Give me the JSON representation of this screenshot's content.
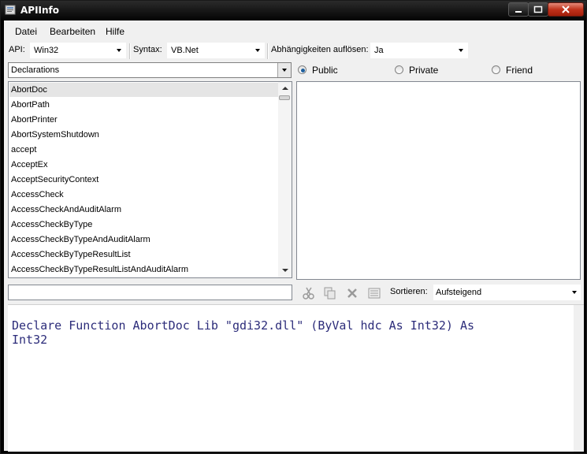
{
  "window": {
    "title": "APIInfo"
  },
  "menu": [
    "Datei",
    "Bearbeiten",
    "Hilfe"
  ],
  "toolbar": {
    "api_label": "API:",
    "api_value": "Win32",
    "syntax_label": "Syntax:",
    "syntax_value": "VB.Net",
    "deps_label": "Abhängigkeiten auflösen:",
    "deps_value": "Ja"
  },
  "declarations": {
    "value": "Declarations"
  },
  "scope": {
    "options": [
      "Public",
      "Private",
      "Friend"
    ],
    "selected": "Public"
  },
  "api_list": {
    "items": [
      "AbortDoc",
      "AbortPath",
      "AbortPrinter",
      "AbortSystemShutdown",
      "accept",
      "AcceptEx",
      "AcceptSecurityContext",
      "AccessCheck",
      "AccessCheckAndAuditAlarm",
      "AccessCheckByType",
      "AccessCheckByTypeAndAuditAlarm",
      "AccessCheckByTypeResultList",
      "AccessCheckByTypeResultListAndAuditAlarm"
    ],
    "selected": "AbortDoc"
  },
  "filter": {
    "value": ""
  },
  "actions": {
    "icons": [
      "scissors-icon",
      "copy-icon",
      "delete-icon",
      "list-icon"
    ]
  },
  "sort": {
    "label": "Sortieren:",
    "value": "Aufsteigend"
  },
  "code": {
    "text": "Declare Function AbortDoc Lib \"gdi32.dll\" (ByVal hdc As Int32) As\nInt32"
  }
}
